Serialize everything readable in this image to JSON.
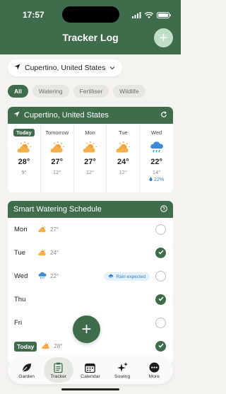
{
  "status": {
    "time": "17:57"
  },
  "header": {
    "title": "Tracker Log",
    "add_icon": "plus-icon"
  },
  "location": {
    "label": "Cupertino, United States"
  },
  "filters": [
    "All",
    "Watering",
    "Fertiliser",
    "Wildlife"
  ],
  "weather": {
    "title": "Cupertino, United States",
    "days": [
      {
        "label": "Today",
        "icon": "partly-sunny",
        "high": "28°",
        "low": "9°"
      },
      {
        "label": "Tomorrow",
        "icon": "partly-sunny",
        "high": "27°",
        "low": "12°"
      },
      {
        "label": "Mon",
        "icon": "partly-sunny",
        "high": "27°",
        "low": "12°"
      },
      {
        "label": "Tue",
        "icon": "partly-sunny",
        "high": "24°",
        "low": "12°"
      },
      {
        "label": "Wed",
        "icon": "rain",
        "high": "22°",
        "low": "14°",
        "rain": "22%"
      }
    ]
  },
  "schedule": {
    "title": "Smart Watering Schedule",
    "rows": [
      {
        "day": "Mon",
        "temp": "27°",
        "checked": false
      },
      {
        "day": "Tue",
        "temp": "24°",
        "checked": true
      },
      {
        "day": "Wed",
        "temp": "22°",
        "checked": false,
        "badge": "Rain expected"
      },
      {
        "day": "Thu",
        "temp": "",
        "checked": true
      },
      {
        "day": "Fri",
        "temp": "",
        "checked": false
      },
      {
        "day": "Today",
        "temp": "28°",
        "checked": true
      }
    ]
  },
  "tabs": [
    {
      "label": "Garden",
      "icon": "leaf-icon"
    },
    {
      "label": "Tracker",
      "icon": "clipboard-icon",
      "active": true
    },
    {
      "label": "Calendar",
      "icon": "calendar-icon"
    },
    {
      "label": "Sowing",
      "icon": "sparkles-icon"
    },
    {
      "label": "More",
      "icon": "ellipsis-icon"
    }
  ],
  "colors": {
    "primary": "#3f6d4c",
    "rain": "#2f7fc7",
    "sun": "#f2a23a"
  }
}
